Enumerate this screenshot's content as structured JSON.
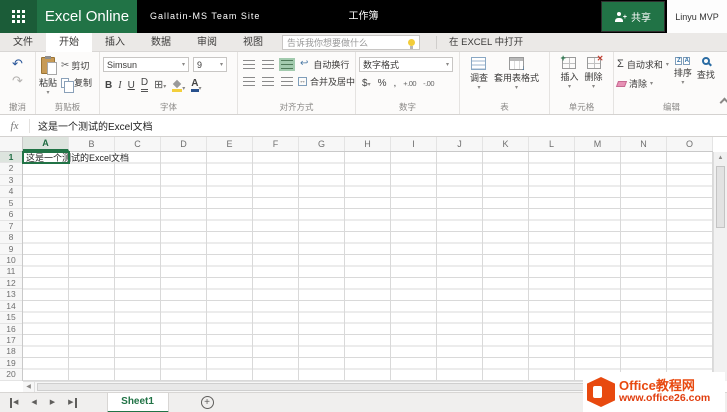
{
  "topbar": {
    "brand": "Excel Online",
    "site_name": "Gallatin-MS Team Site",
    "doc_title": "工作簿",
    "share_label": "共享",
    "user_name": "Linyu MVP"
  },
  "menubar": {
    "tabs": [
      "文件",
      "开始",
      "插入",
      "数据",
      "审阅",
      "视图"
    ],
    "active_tab": "开始",
    "search_placeholder": "告诉我你想要做什么",
    "open_in_excel": "在 EXCEL 中打开"
  },
  "ribbon": {
    "undo": {
      "group_label": "撤消"
    },
    "clipboard": {
      "group_label": "剪贴板",
      "paste": "粘贴",
      "cut": "剪切",
      "copy": "复制"
    },
    "font": {
      "group_label": "字体",
      "font_name": "Simsun",
      "font_size": "9",
      "bold": "B",
      "italic": "I",
      "underline": "U",
      "double_underline": "D"
    },
    "alignment": {
      "group_label": "对齐方式",
      "wrap_text": "自动换行",
      "merge_center": "合并及居中"
    },
    "number": {
      "group_label": "数字",
      "number_format": "数字格式",
      "currency": "$",
      "percent": "%",
      "comma": ",",
      "inc_decimal": "+.00",
      "dec_decimal": "-.00"
    },
    "table": {
      "group_label": "表",
      "survey": "调查",
      "format_as_table": "套用表格式"
    },
    "cells": {
      "group_label": "单元格",
      "insert": "插入",
      "delete": "删除"
    },
    "editing": {
      "group_label": "编辑",
      "autosum": "自动求和",
      "sigma": "Σ",
      "clear": "清除",
      "sort": "排序",
      "find": "查找"
    }
  },
  "formula_bar": {
    "fx_label": "fx",
    "value": "这是一个测试的Excel文档"
  },
  "grid": {
    "columns": [
      "A",
      "B",
      "C",
      "D",
      "E",
      "F",
      "G",
      "H",
      "I",
      "J",
      "K",
      "L",
      "M",
      "N",
      "O"
    ],
    "rows": [
      "1",
      "2",
      "3",
      "4",
      "5",
      "6",
      "7",
      "8",
      "9",
      "10",
      "11",
      "12",
      "13",
      "14",
      "15",
      "16",
      "17",
      "18",
      "19",
      "20"
    ],
    "selected_column": "A",
    "selected_row": "1",
    "selected_cell": "A1",
    "cells": {
      "A1": "这是一个测试的Excel文档"
    }
  },
  "sheet_bar": {
    "sheet_name": "Sheet1",
    "add_label": "+"
  },
  "watermark": {
    "site_title": "Office教程网",
    "site_url": "www.office26.com"
  },
  "glyphs": {
    "undo": "↶",
    "redo": "↷",
    "cut": "✂",
    "borders": "⊞",
    "wrap": "↩",
    "merge": "↔",
    "caret": "▾",
    "up": "▲",
    "down": "▼",
    "left": "◀",
    "right": "▶",
    "sort_a": "A",
    "sort_z": "Z",
    "person_plus": "+"
  },
  "colors": {
    "excel_green": "#217346",
    "topbar_black": "#000000",
    "fill_yellow": "#f3cf3c",
    "font_color_bar": "#28508c",
    "watermark_orange": "#e8490f"
  }
}
